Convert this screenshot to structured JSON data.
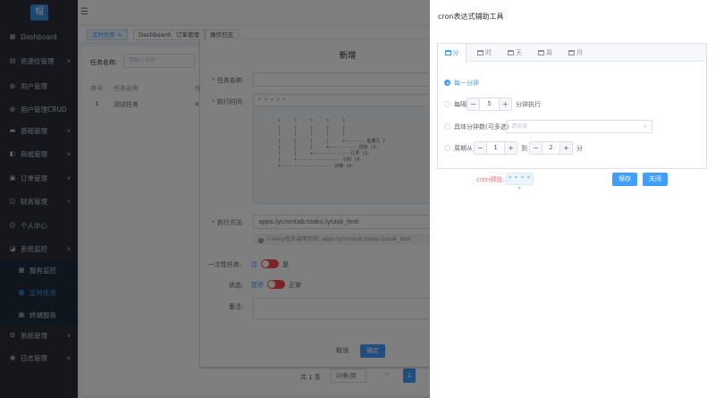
{
  "sidebar": {
    "logo": "帽",
    "items": [
      {
        "label": "Dashboard",
        "icon": "dashboard-icon",
        "glyph": "▦"
      },
      {
        "label": "资源位管理",
        "icon": "resource-icon",
        "glyph": "▤",
        "caret": "∨"
      },
      {
        "label": "用户管理",
        "icon": "user-icon",
        "glyph": "◍"
      },
      {
        "label": "用户管理CRUD",
        "icon": "user-crud-icon",
        "glyph": "◍"
      },
      {
        "label": "基础管理",
        "icon": "base-icon",
        "glyph": "▬",
        "caret": "∨"
      },
      {
        "label": "商城管理",
        "icon": "shop-icon",
        "glyph": "◧",
        "caret": "∨"
      },
      {
        "label": "订单管理",
        "icon": "order-icon",
        "glyph": "▣",
        "caret": "∨"
      },
      {
        "label": "财务管理",
        "icon": "finance-icon",
        "glyph": "◫",
        "caret": "∨"
      },
      {
        "label": "个人中心",
        "icon": "person-icon",
        "glyph": "☺"
      },
      {
        "label": "系统监控",
        "icon": "monitor-icon",
        "glyph": "◪",
        "caret": "∧"
      },
      {
        "label": "服务监控",
        "icon": "server-icon",
        "glyph": "▦",
        "sub": true
      },
      {
        "label": "定时任务",
        "icon": "schedule-icon",
        "glyph": "▦",
        "sub": true,
        "active": true
      },
      {
        "label": "终端服务",
        "icon": "terminal-icon",
        "glyph": "▦",
        "sub": true
      },
      {
        "label": "系统管理",
        "icon": "system-icon",
        "glyph": "⚙",
        "caret": "∨"
      },
      {
        "label": "日志管理",
        "icon": "log-icon",
        "glyph": "◉",
        "caret": "∨"
      }
    ]
  },
  "tags": [
    "定时任务 ×",
    "Dashboard",
    "订单管理",
    "操作日志"
  ],
  "background": {
    "search_label": "任务名称:",
    "search_placeholder": "请输入名称",
    "table_headers": [
      "序号",
      "任务名称",
      "任"
    ],
    "table_row": [
      "1",
      "测试任务",
      "a"
    ],
    "pager_total": "共 1 条",
    "pager_size": "10条/页",
    "pager_prev": "<",
    "pager_page": "1"
  },
  "dialog": {
    "title": "新增",
    "fields": {
      "name_label": "任务名称:",
      "cron_label": "执行时间:",
      "cron_value": "* * * * *",
      "method_label": "执行方法:",
      "method_value": "apps.lycrontab.tasks.lytask_test",
      "method_tip": "Celery任务调用示例:  apps.lycrontab.tasks.lytask_test",
      "oneoff_label": "一次性任务:",
      "oneoff_on": "是",
      "oneoff_off": "否",
      "status_label": "状态:",
      "status_off": "暂停",
      "status_on": "正常",
      "remark_label": "备注:"
    },
    "cron_diagram": " *     *     *     *     *\n |     |     |     |     |\n |     |     |     |     |\n |     |     |     |     +------- 星期几 (\n |     |     |     +---------- 月份 (1-\n |     |     +------------- 几号 (1-\n |     +---------------- 小时 (0-\n +------------------- 分钟 (0-",
    "cancel": "取消",
    "ok": "确定"
  },
  "drawer": {
    "title": "cron表达式辅助工具",
    "tabs": [
      "分",
      "时",
      "天",
      "周",
      "月"
    ],
    "options": {
      "every_minute": "每一分钟",
      "every_prefix": "每隔",
      "every_value": "5",
      "every_suffix": "分钟执行",
      "specific_label": "具体分钟数(可多选)",
      "specific_placeholder": "请选择",
      "range_prefix": "周期从",
      "range_from": "1",
      "range_to_label": "到",
      "range_to": "2",
      "range_suffix": "分"
    },
    "stepper_minus": "−",
    "stepper_plus": "+",
    "preview_label": "cron预览:",
    "preview_value": "* * * * *",
    "save": "保存",
    "close": "关闭"
  },
  "colors": {
    "primary": "#409eff",
    "sidebar_bg": "#2b2f3a",
    "switch_off": "#ff4949",
    "danger_text": "#f56c6c"
  }
}
